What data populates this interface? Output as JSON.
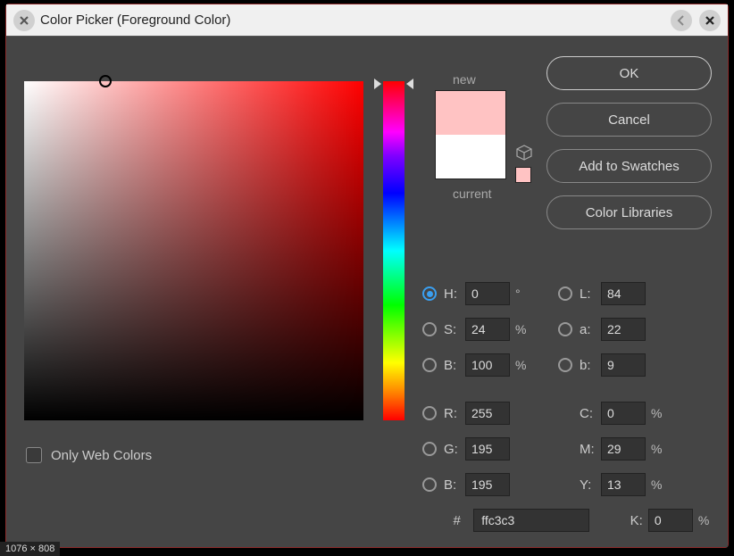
{
  "window": {
    "title": "Color Picker (Foreground Color)"
  },
  "buttons": {
    "ok": "OK",
    "cancel": "Cancel",
    "add_swatches": "Add to Swatches",
    "color_libraries": "Color Libraries"
  },
  "preview": {
    "new_label": "new",
    "current_label": "current",
    "new_color": "#ffc3c3",
    "current_color": "#ffffff"
  },
  "web_only": {
    "label": "Only Web Colors",
    "checked": false
  },
  "hsb": {
    "h": "0",
    "h_suffix": "°",
    "s": "24",
    "s_suffix": "%",
    "b": "100",
    "b_suffix": "%"
  },
  "lab": {
    "l": "84",
    "a": "22",
    "b": "9"
  },
  "rgb": {
    "r": "255",
    "g": "195",
    "b": "195"
  },
  "cmyk": {
    "c": "0",
    "c_suffix": "%",
    "m": "29",
    "m_suffix": "%",
    "y": "13",
    "y_suffix": "%",
    "k": "0",
    "k_suffix": "%"
  },
  "hex": {
    "prefix": "#",
    "value": "ffc3c3"
  },
  "labels": {
    "H": "H:",
    "S": "S:",
    "Bhsb": "B:",
    "L": "L:",
    "a": "a:",
    "blab": "b:",
    "R": "R:",
    "G": "G:",
    "Brgb": "B:",
    "C": "C:",
    "M": "M:",
    "Y": "Y:",
    "K": "K:"
  },
  "badge": "1076 × 808",
  "selected_radio": "H"
}
